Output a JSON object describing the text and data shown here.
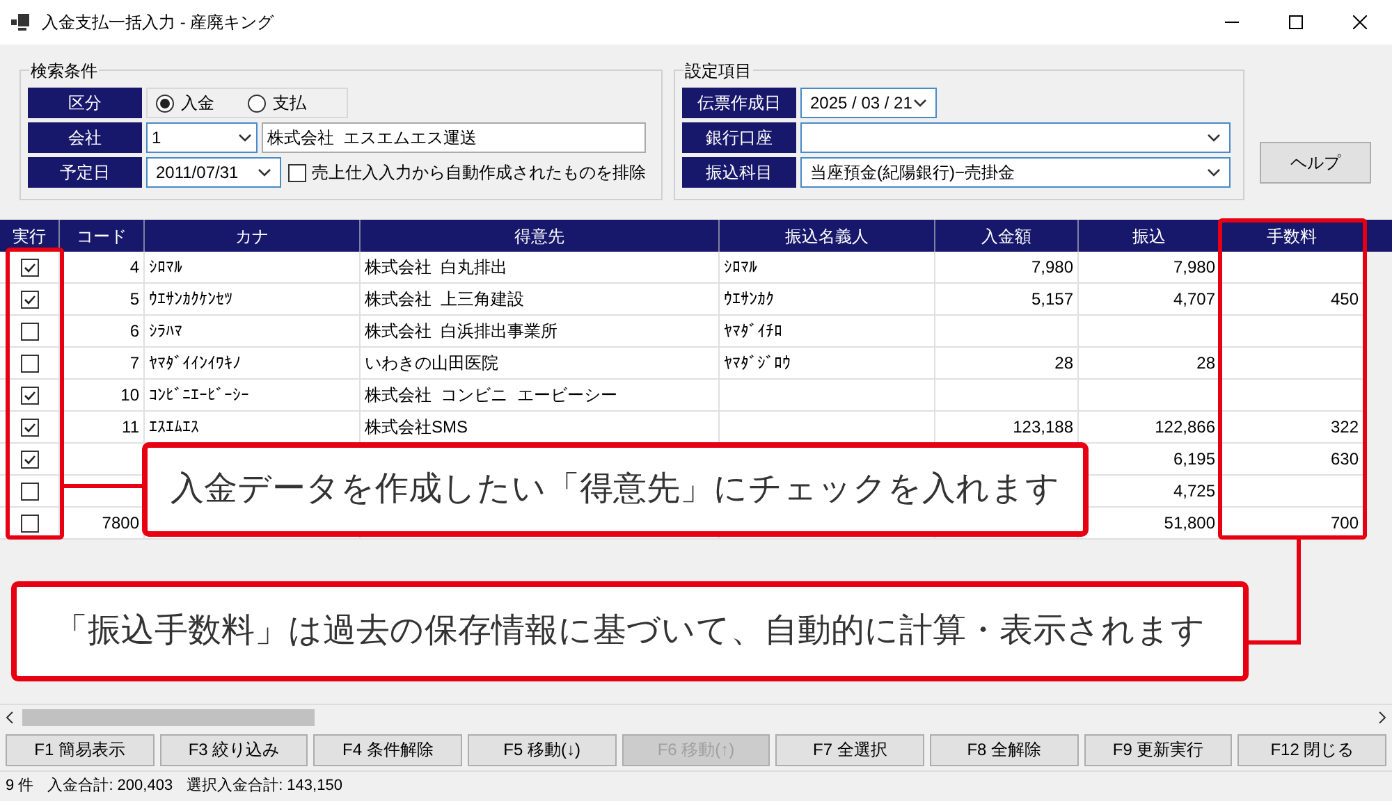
{
  "window": {
    "title": "入金支払一括入力 - 産廃キング"
  },
  "search_conditions": {
    "title": "検索条件",
    "fields": [
      {
        "kind": "radio",
        "label": "区分",
        "options": [
          {
            "label": "入金",
            "selected": true
          },
          {
            "label": "支払",
            "selected": false
          }
        ]
      },
      {
        "kind": "company",
        "label": "会社",
        "value": "1",
        "name": "株式会社  エスエムエス運送"
      },
      {
        "kind": "date",
        "label": "予定日",
        "value": "2011/07/31",
        "checkbox": {
          "label": "売上仕入入力から自動作成されたものを排除",
          "checked": false
        }
      }
    ]
  },
  "settings": {
    "title": "設定項目",
    "fields": [
      {
        "kind": "date",
        "label": "伝票作成日",
        "value": "2025 / 03 / 21"
      },
      {
        "kind": "select",
        "label": "銀行口座"
      },
      {
        "kind": "select",
        "label": "振込科目",
        "value": "当座預金(紀陽銀行)−売掛金"
      }
    ]
  },
  "help_button": "ヘルプ",
  "table": {
    "columns": [
      "実行",
      "コード",
      "カナ",
      "得意先",
      "振込名義人",
      "入金額",
      "振込",
      "手数料"
    ],
    "rows": [
      {
        "checked": true,
        "code": "4",
        "kana": "ｼﾛﾏﾙ",
        "customer": "株式会社  白丸排出",
        "payer": "ｼﾛﾏﾙ",
        "amount": "7,980",
        "transfer": "7,980"
      },
      {
        "checked": true,
        "code": "5",
        "kana": "ｳｴｻﾝｶｸｹﾝｾﾂ",
        "customer": "株式会社  上三角建設",
        "payer": "ｳｴｻﾝｶｸ",
        "amount": "5,157",
        "transfer": "4,707",
        "fee": "450"
      },
      {
        "checked": false,
        "code": "6",
        "kana": "ｼﾗﾊﾏ",
        "customer": "株式会社  白浜排出事業所",
        "payer": "ﾔﾏﾀﾞｲﾁﾛ"
      },
      {
        "checked": false,
        "code": "7",
        "kana": "ﾔﾏﾀﾞｲｲﾝｲﾜｷﾉ",
        "customer": "いわきの山田医院",
        "payer": "ﾔﾏﾀﾞｼﾞﾛｳ",
        "amount": "28",
        "transfer": "28"
      },
      {
        "checked": true,
        "code": "10",
        "kana": "ｺﾝﾋﾞﾆｴｰﾋﾞｰｼｰ",
        "customer": "株式会社  コンビニ  エービーシー"
      },
      {
        "checked": true,
        "code": "11",
        "kana": "ｴｽｴﾑｴｽ",
        "customer": "株式会社SMS",
        "amount": "123,188",
        "transfer": "122,866",
        "fee": "322"
      },
      {
        "checked": true,
        "transfer": "6,195",
        "fee": "630"
      },
      {
        "checked": false,
        "transfer": "4,725"
      },
      {
        "checked": false,
        "code": "7800",
        "transfer": "51,800",
        "fee": "700"
      }
    ]
  },
  "callouts": [
    {
      "text": "入金データを作成したい「得意先」にチェックを入れます"
    },
    {
      "text": "「振込手数料」は過去の保存情報に基づいて、自動的に計算・表示されます"
    }
  ],
  "function_keys": [
    {
      "label": "F1 簡易表示",
      "disabled": false
    },
    {
      "label": "F3 絞り込み",
      "disabled": false
    },
    {
      "label": "F4 条件解除",
      "disabled": false
    },
    {
      "label": "F5 移動(↓)",
      "disabled": false
    },
    {
      "label": "F6 移動(↑)",
      "disabled": true
    },
    {
      "label": "F7 全選択",
      "disabled": false
    },
    {
      "label": "F8 全解除",
      "disabled": false
    },
    {
      "label": "F9 更新実行",
      "disabled": false
    },
    {
      "label": "F12 閉じる",
      "disabled": false
    }
  ],
  "status_bar": [
    "9 件",
    "入金合計: 200,403",
    "選択入金合計: 143,150"
  ]
}
